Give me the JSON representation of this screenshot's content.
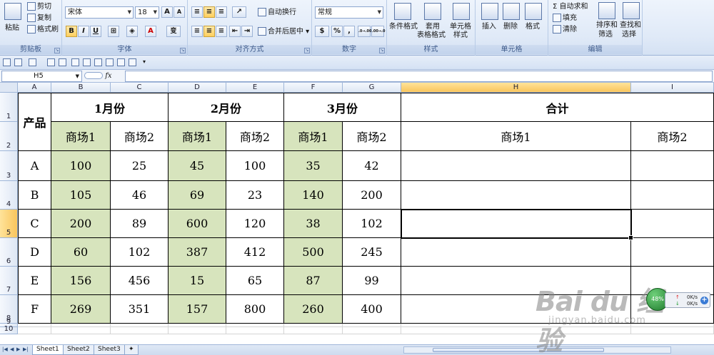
{
  "ribbon": {
    "clipboard": {
      "label": "剪贴板",
      "paste": "粘贴",
      "cut": "剪切",
      "copy": "复制",
      "format_painter": "格式刷"
    },
    "font": {
      "label": "字体",
      "name": "宋体",
      "size": "18",
      "grow": "A",
      "shrink": "A",
      "bold": "B",
      "italic": "I",
      "underline": "U",
      "font_color": "A",
      "phonetic": "变"
    },
    "alignment": {
      "label": "对齐方式",
      "wrap": "自动换行",
      "merge": "合并后居中"
    },
    "number": {
      "label": "数字",
      "format": "常规",
      "percent": "%",
      "comma": ",",
      "inc_decimal": ".0→.00",
      "dec_decimal": ".00→.0"
    },
    "styles": {
      "label": "样式",
      "conditional": "条件格式",
      "table_format_1": "套用",
      "table_format_2": "表格格式",
      "cell_style_1": "单元格",
      "cell_style_2": "样式"
    },
    "cells": {
      "label": "单元格",
      "insert": "插入",
      "delete": "删除",
      "format": "格式"
    },
    "editing": {
      "label": "编辑",
      "autosum": "自动求和",
      "fill": "填充",
      "clear": "清除",
      "sort_1": "排序和",
      "sort_2": "筛选",
      "find_1": "查找和",
      "find_2": "选择"
    }
  },
  "formula_bar": {
    "name_box": "H5",
    "fx": "fx",
    "value": ""
  },
  "columns": [
    "A",
    "B",
    "C",
    "D",
    "E",
    "F",
    "G",
    "H",
    "I"
  ],
  "rows": [
    "1",
    "2",
    "3",
    "4",
    "5",
    "6",
    "7",
    "8",
    "9",
    "10"
  ],
  "table": {
    "product_header": "产品",
    "month_headers": [
      "1月份",
      "2月份",
      "3月份"
    ],
    "total_header": "合计",
    "sub_headers": [
      "商场1",
      "商场2",
      "商场1",
      "商场2",
      "商场1",
      "商场2",
      "商场1",
      "商场2"
    ],
    "products": [
      "A",
      "B",
      "C",
      "D",
      "E",
      "F"
    ],
    "data": [
      [
        "100",
        "25",
        "45",
        "100",
        "35",
        "42"
      ],
      [
        "105",
        "46",
        "69",
        "23",
        "140",
        "200"
      ],
      [
        "200",
        "89",
        "600",
        "120",
        "38",
        "102"
      ],
      [
        "60",
        "102",
        "387",
        "412",
        "500",
        "245"
      ],
      [
        "156",
        "456",
        "15",
        "65",
        "87",
        "99"
      ],
      [
        "269",
        "351",
        "157",
        "800",
        "260",
        "400"
      ]
    ]
  },
  "sheets": [
    "Sheet1",
    "Sheet2",
    "Sheet3"
  ],
  "net_widget": {
    "percent": "48%",
    "up": "0K/s",
    "down": "0K/s"
  },
  "watermark": {
    "main": "Bai du 经验",
    "sub": "jingyan.baidu.com"
  },
  "colors": {
    "green_fill": "#d7e4bd",
    "header_selected": "#f9c55c",
    "ribbon_bg": "#dfe9f7"
  }
}
